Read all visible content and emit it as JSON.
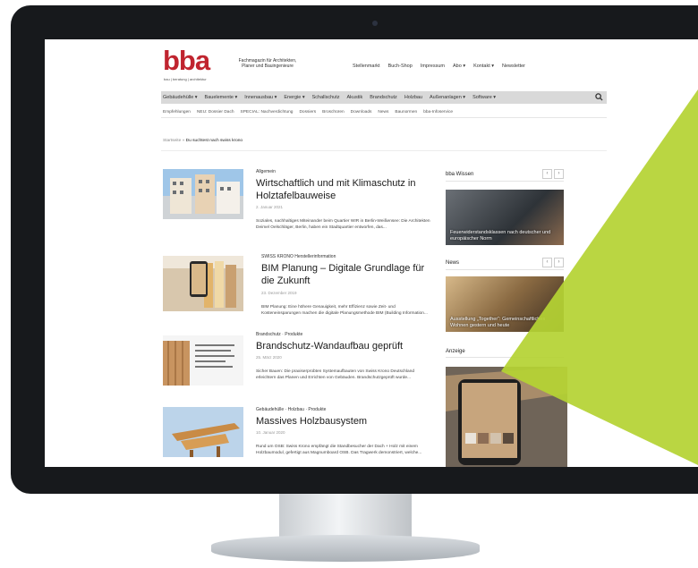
{
  "brand": {
    "logo": "bba",
    "logo_sub": "bau | beratung | architektur",
    "tagline": "Fachmagazin für Architekten, Planer und Bauingenieure"
  },
  "top_nav": [
    "Stellenmarkt",
    "Buch-Shop",
    "Impressum",
    "Abo ▾",
    "Kontakt ▾",
    "Newsletter"
  ],
  "main_nav": [
    "Gebäudehülle ▾",
    "Bauelemente ▾",
    "Innenausbau ▾",
    "Energie ▾",
    "Schallschutz",
    "Akustik",
    "Brandschutz",
    "Holzbau",
    "Außenanlagen ▾",
    "Software ▾"
  ],
  "sub_nav": [
    "Empfehlungen",
    "NEU: Dossier Dach",
    "SPECIAL: Nachverdichtung",
    "Dossiers",
    "Broschüren",
    "Downloads",
    "News",
    "Baunormen",
    "bba-Infoservice"
  ],
  "breadcrumb": {
    "home": "Startseite",
    "sep": "»",
    "current": "Du suchtest nach swiss krono"
  },
  "articles": [
    {
      "category": "Allgemein",
      "title": "Wirtschaftlich und mit Klimaschutz in Holztafelbauweise",
      "date": "2. Januar 2021",
      "excerpt": "Soziales, nachhaltiges Miteinander beim Quartier WIR in Berlin-Weißensee: Die Architekten Deimel Oelschläger, Berlin, haben ein Stadtquartier entworfen, das..."
    },
    {
      "category": "SWISS KRONO Herstellerinformation",
      "title": "BIM Planung – Digitale Grundlage für die Zukunft",
      "date": "23. Dezember 2019",
      "excerpt": "BIM Planung: Eine höhere Genauigkeit, mehr Effizienz sowie Zeit- und Kosteneinsparungen machen die digitale Planungsmethode BIM (Building Information..."
    },
    {
      "category": "Brandschutz · Produkte",
      "title": "Brandschutz-Wandaufbau geprüft",
      "date": "25. März 2020",
      "excerpt": "Sicher Bauen: Die praxiserprobten Systemaufbauten von Swiss Krono Deutschland erleichtern das Planen und Errichten von Gebäuden. Brandschutzgeprüft wurde..."
    },
    {
      "category": "Gebäudehülle · Holzbau · Produkte",
      "title": "Massives Holzbausystem",
      "date": "10. Januar 2020",
      "excerpt": "Rund um OSB: Swiss Krono empfängt die Standbesucher der Dach + Holz mit einem Holzbaumodul, gefertigt aus Magnumboard OSB. Das Tragwerk demonstriert, welche..."
    }
  ],
  "sidebar": {
    "wissen_title": "bba Wissen",
    "wissen_caption": "Feuerwiderstandsklassen nach deutscher und europäischer Norm",
    "news_title": "News",
    "news_caption": "Ausstellung „Together“: Gemeinschaftliches Wohnen gestern und heute",
    "ad_title": "Anzeige",
    "prev": "‹",
    "next": "›"
  },
  "icons": {
    "search": "search-icon"
  },
  "colors": {
    "brand_red": "#c0242f",
    "accent_green": "#b5d334",
    "nav_gray": "#d9d9d9",
    "bezel": "#17191c"
  }
}
